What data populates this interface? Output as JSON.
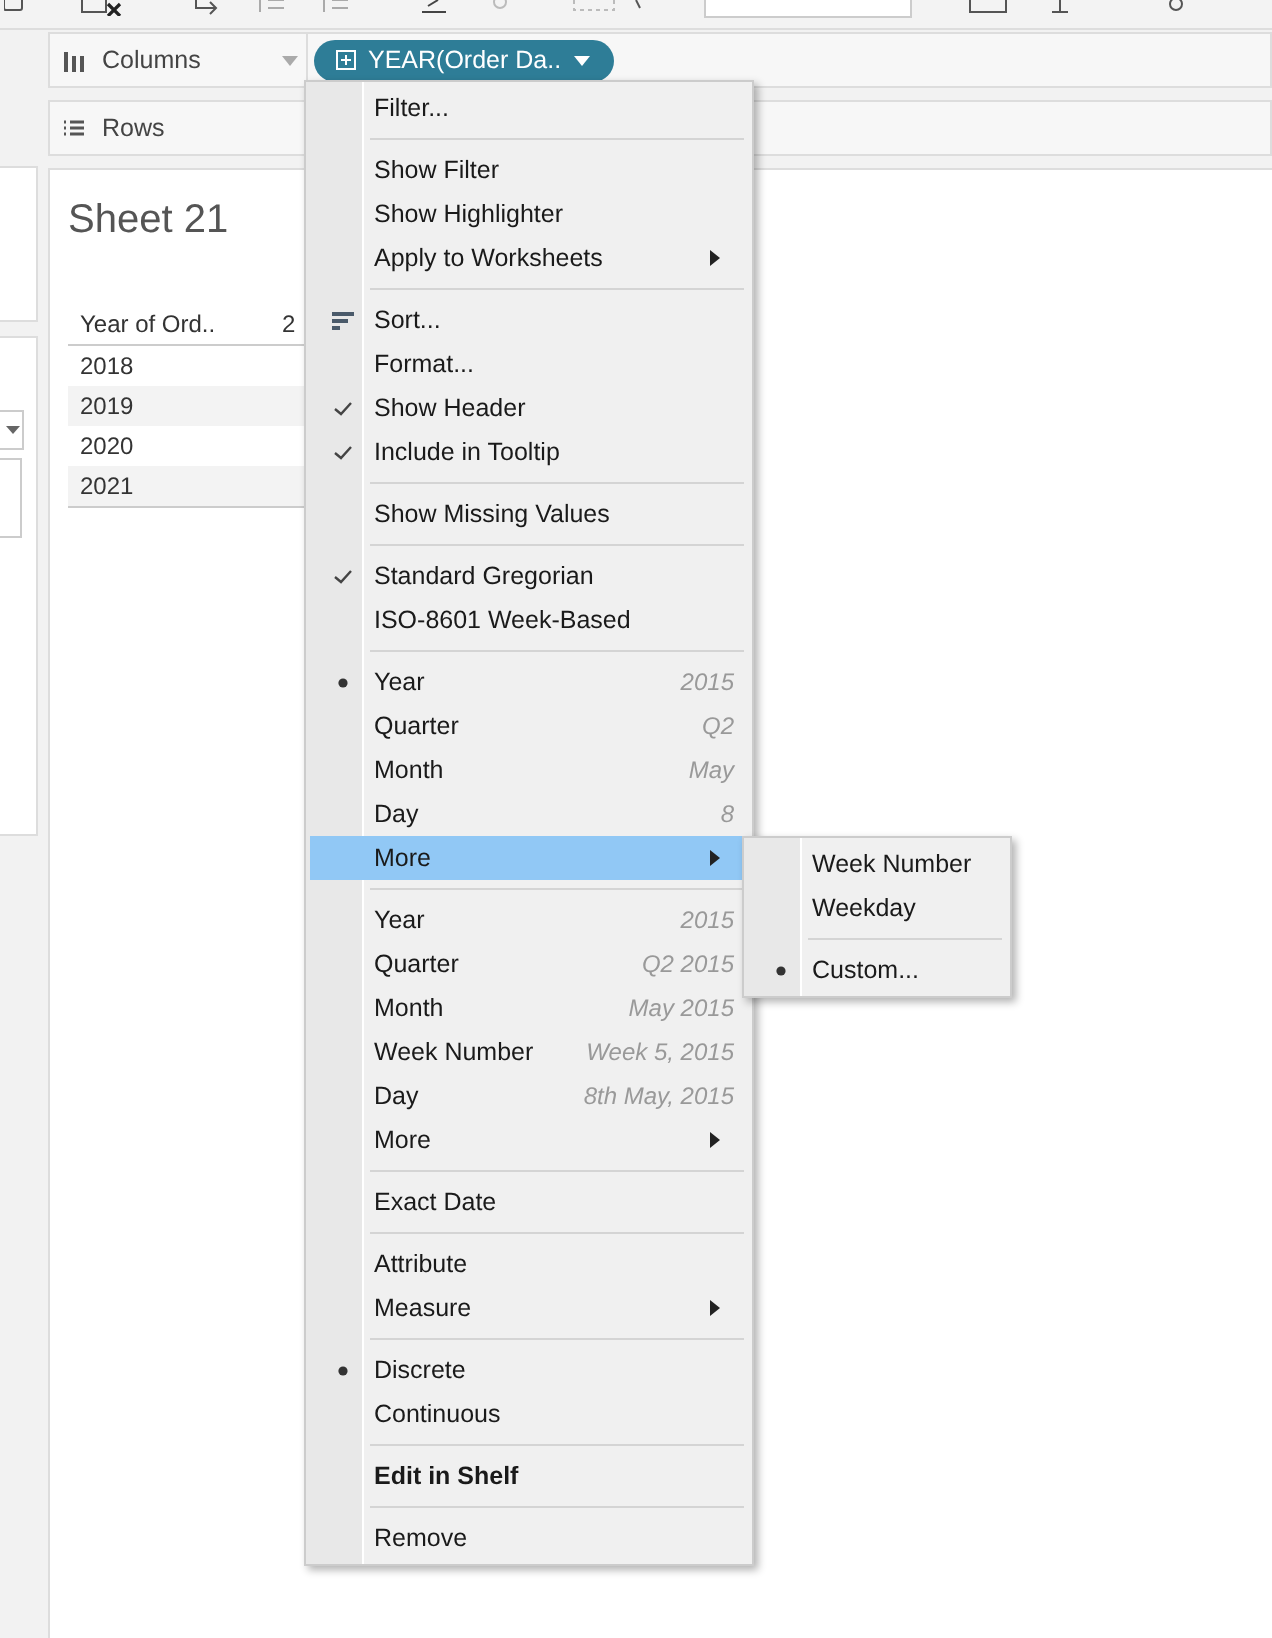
{
  "shelves": {
    "columns_label": "Columns",
    "rows_label": "Rows",
    "pill": "YEAR(Order Da.."
  },
  "sheet": {
    "title": "Sheet 21",
    "table": {
      "columns": [
        "Year of Ord..",
        "2"
      ],
      "rows": [
        "2018",
        "2019",
        "2020",
        "2021"
      ]
    }
  },
  "menu": {
    "groups": [
      [
        {
          "kind": "action",
          "label": "Filter..."
        }
      ],
      [
        {
          "kind": "action",
          "label": "Show Filter"
        },
        {
          "kind": "action",
          "label": "Show Highlighter"
        },
        {
          "kind": "submenu",
          "label": "Apply to Worksheets",
          "selected": false
        }
      ],
      [
        {
          "kind": "sort",
          "label": "Sort..."
        },
        {
          "kind": "action",
          "label": "Format..."
        },
        {
          "kind": "check",
          "label": "Show Header",
          "checked": true
        },
        {
          "kind": "check",
          "label": "Include in Tooltip",
          "checked": true
        }
      ],
      [
        {
          "kind": "action",
          "label": "Show Missing Values"
        }
      ],
      [
        {
          "kind": "check",
          "label": "Standard Gregorian",
          "checked": true
        },
        {
          "kind": "check",
          "label": "ISO-8601 Week-Based",
          "checked": false
        }
      ],
      [
        {
          "kind": "radio",
          "label": "Year",
          "hint": "2015",
          "checked": true
        },
        {
          "kind": "radio",
          "label": "Quarter",
          "hint": "Q2",
          "checked": false
        },
        {
          "kind": "radio",
          "label": "Month",
          "hint": "May",
          "checked": false
        },
        {
          "kind": "radio",
          "label": "Day",
          "hint": "8",
          "checked": false
        },
        {
          "kind": "submenu",
          "label": "More",
          "selected": true
        }
      ],
      [
        {
          "kind": "radio",
          "label": "Year",
          "hint": "2015",
          "checked": false
        },
        {
          "kind": "radio",
          "label": "Quarter",
          "hint": "Q2 2015",
          "checked": false
        },
        {
          "kind": "radio",
          "label": "Month",
          "hint": "May 2015",
          "checked": false
        },
        {
          "kind": "radio",
          "label": "Week Number",
          "hint": "Week 5, 2015",
          "checked": false
        },
        {
          "kind": "radio",
          "label": "Day",
          "hint": "8th May, 2015",
          "checked": false
        },
        {
          "kind": "submenu",
          "label": "More",
          "selected": false
        }
      ],
      [
        {
          "kind": "action",
          "label": "Exact Date"
        }
      ],
      [
        {
          "kind": "action",
          "label": "Attribute"
        },
        {
          "kind": "submenu",
          "label": "Measure",
          "selected": false
        }
      ],
      [
        {
          "kind": "radio",
          "label": "Discrete",
          "checked": true
        },
        {
          "kind": "radio",
          "label": "Continuous",
          "checked": false
        }
      ],
      [
        {
          "kind": "bold",
          "label": "Edit in Shelf"
        }
      ],
      [
        {
          "kind": "action",
          "label": "Remove"
        }
      ]
    ]
  },
  "submenu": {
    "groups": [
      [
        {
          "kind": "radio",
          "label": "Week Number",
          "checked": false
        },
        {
          "kind": "radio",
          "label": "Weekday",
          "checked": false
        }
      ],
      [
        {
          "kind": "radio",
          "label": "Custom...",
          "checked": true
        }
      ]
    ]
  }
}
